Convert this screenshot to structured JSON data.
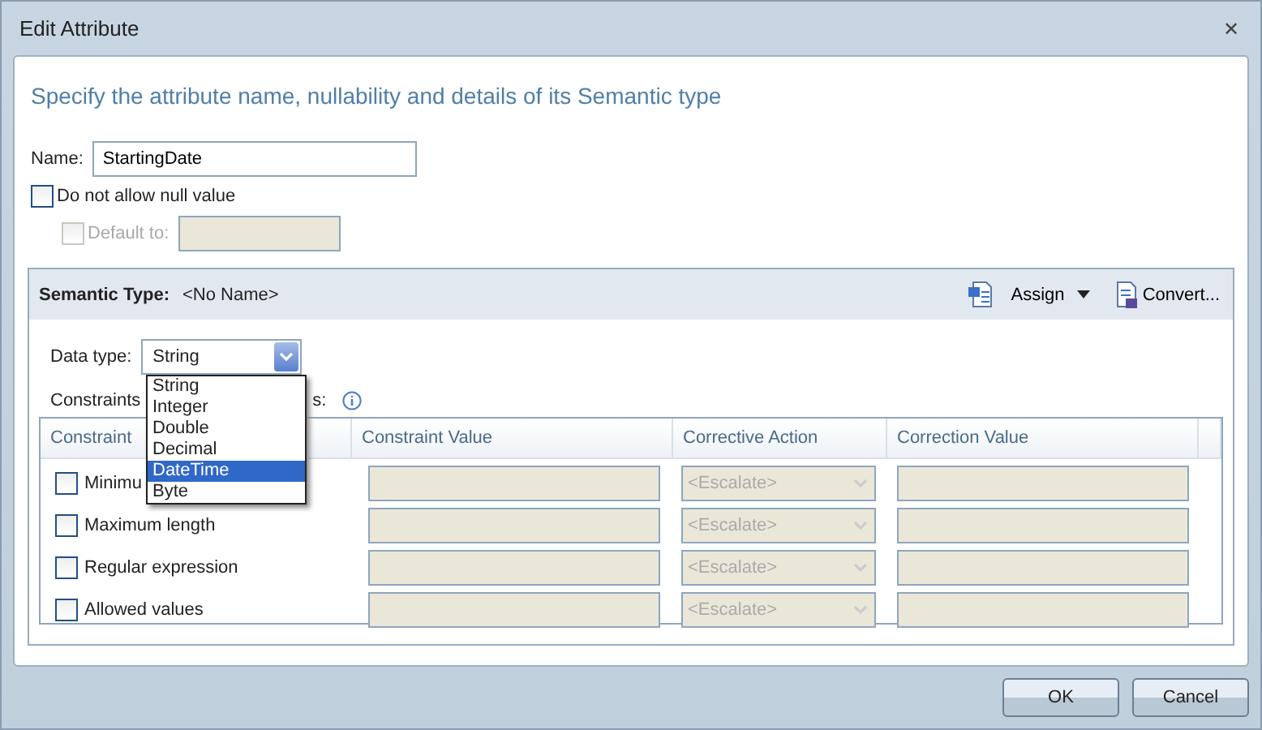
{
  "window": {
    "title": "Edit Attribute",
    "close": "✕"
  },
  "heading": "Specify the attribute name, nullability and details of its Semantic type",
  "name_field": {
    "label": "Name:",
    "value": "StartingDate"
  },
  "not_null": {
    "label": "Do not allow null value",
    "checked": false
  },
  "default_to": {
    "label": "Default to:",
    "checked": false,
    "disabled": true
  },
  "semantic_type": {
    "label": "Semantic Type:",
    "value": "<No Name>",
    "assign": "Assign",
    "convert": "Convert..."
  },
  "data_type": {
    "label": "Data type:",
    "value": "String",
    "expanded": true,
    "options": [
      {
        "label": "String",
        "highlighted": false
      },
      {
        "label": "Integer",
        "highlighted": false
      },
      {
        "label": "Double",
        "highlighted": false
      },
      {
        "label": "Decimal",
        "highlighted": false
      },
      {
        "label": "DateTime",
        "highlighted": true
      },
      {
        "label": "Byte",
        "highlighted": false
      }
    ]
  },
  "constraints_label": {
    "start": "Constraints",
    "end": "s:"
  },
  "table": {
    "columns": [
      "Constraint",
      "Constraint Value",
      "Corrective Action",
      "Correction Value"
    ],
    "rows": [
      {
        "name": "Minimu",
        "checked": false,
        "action": "<Escalate>"
      },
      {
        "name": "Maximum length",
        "checked": false,
        "action": "<Escalate>"
      },
      {
        "name": "Regular expression",
        "checked": false,
        "action": "<Escalate>"
      },
      {
        "name": "Allowed values",
        "checked": false,
        "action": "<Escalate>"
      }
    ]
  },
  "buttons": [
    "OK",
    "Cancel"
  ]
}
